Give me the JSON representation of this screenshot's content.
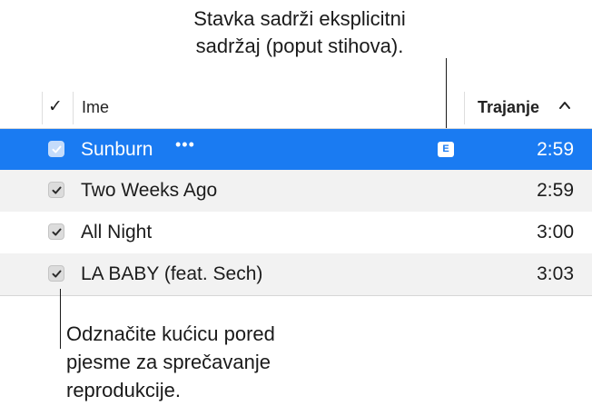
{
  "callouts": {
    "explicit_line1": "Stavka sadrži eksplicitni",
    "explicit_line2": "sadržaj (poput stihova).",
    "checkbox_line1": "Odznačite kućicu pored",
    "checkbox_line2": "pjesme za sprečavanje",
    "checkbox_line3": "reprodukcije."
  },
  "table": {
    "columns": {
      "check": "✓",
      "name": "Ime",
      "duration": "Trajanje"
    },
    "sort": {
      "column": "duration",
      "direction": "ascending",
      "icon": "chevron-up-icon"
    },
    "rows": [
      {
        "title": "Sunburn",
        "more": "•••",
        "explicit_badge": "E",
        "duration": "2:59",
        "checked": true,
        "selected": true
      },
      {
        "title": "Two Weeks Ago",
        "duration": "2:59",
        "checked": true,
        "selected": false
      },
      {
        "title": "All Night",
        "duration": "3:00",
        "checked": true,
        "selected": false
      },
      {
        "title": "LA BABY (feat. Sech)",
        "duration": "3:03",
        "checked": true,
        "selected": false
      }
    ]
  },
  "colors": {
    "selection": "#1a7bf2",
    "alternate_row": "#f2f2f2"
  }
}
